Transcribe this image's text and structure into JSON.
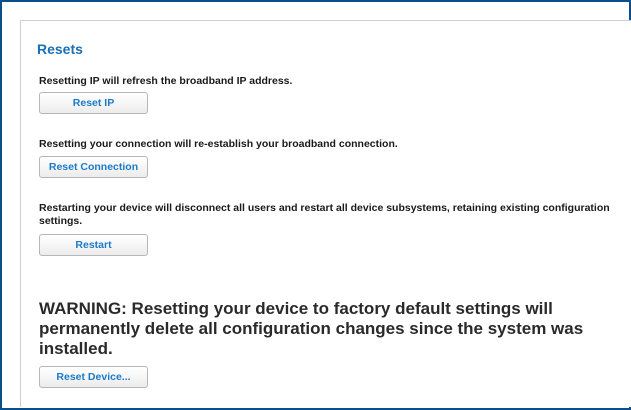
{
  "resets": {
    "title": "Resets",
    "reset_ip": {
      "description": "Resetting IP will refresh the broadband IP address.",
      "button_label": "Reset IP"
    },
    "reset_connection": {
      "description": "Resetting your connection will re-establish your broadband connection.",
      "button_label": "Reset Connection"
    },
    "restart": {
      "description": "Restarting your device will disconnect all users and restart all device subsystems, retaining existing configuration settings.",
      "button_label": "Restart"
    },
    "factory_reset": {
      "warning": "WARNING: Resetting your device to factory default settings will permanently delete all configuration changes since the system was installed.",
      "button_label": "Reset Device..."
    }
  },
  "colors": {
    "frame_border": "#0b4f8a",
    "title": "#1a6fb5",
    "button_text": "#1d7ac9"
  }
}
